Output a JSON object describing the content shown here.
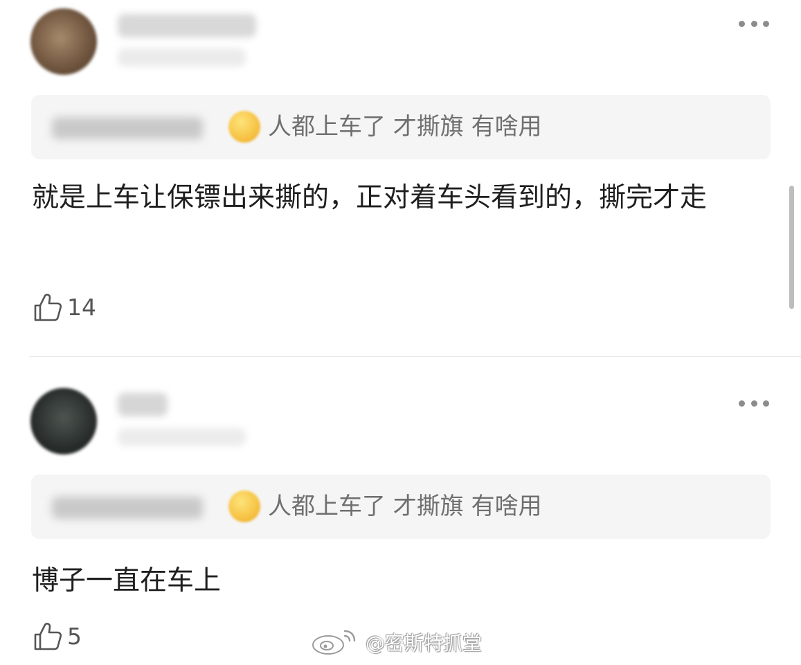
{
  "comments": [
    {
      "quote_text": "人都上车了 才撕旗 有啥用",
      "body": "就是上车让保镖出来撕的，正对着车头看到的，撕完才走",
      "likes": "14"
    },
    {
      "quote_text": "人都上车了 才撕旗 有啥用",
      "body": "博子一直在车上",
      "likes": "5"
    }
  ],
  "watermark": {
    "text": "@密斯特抓堂"
  }
}
